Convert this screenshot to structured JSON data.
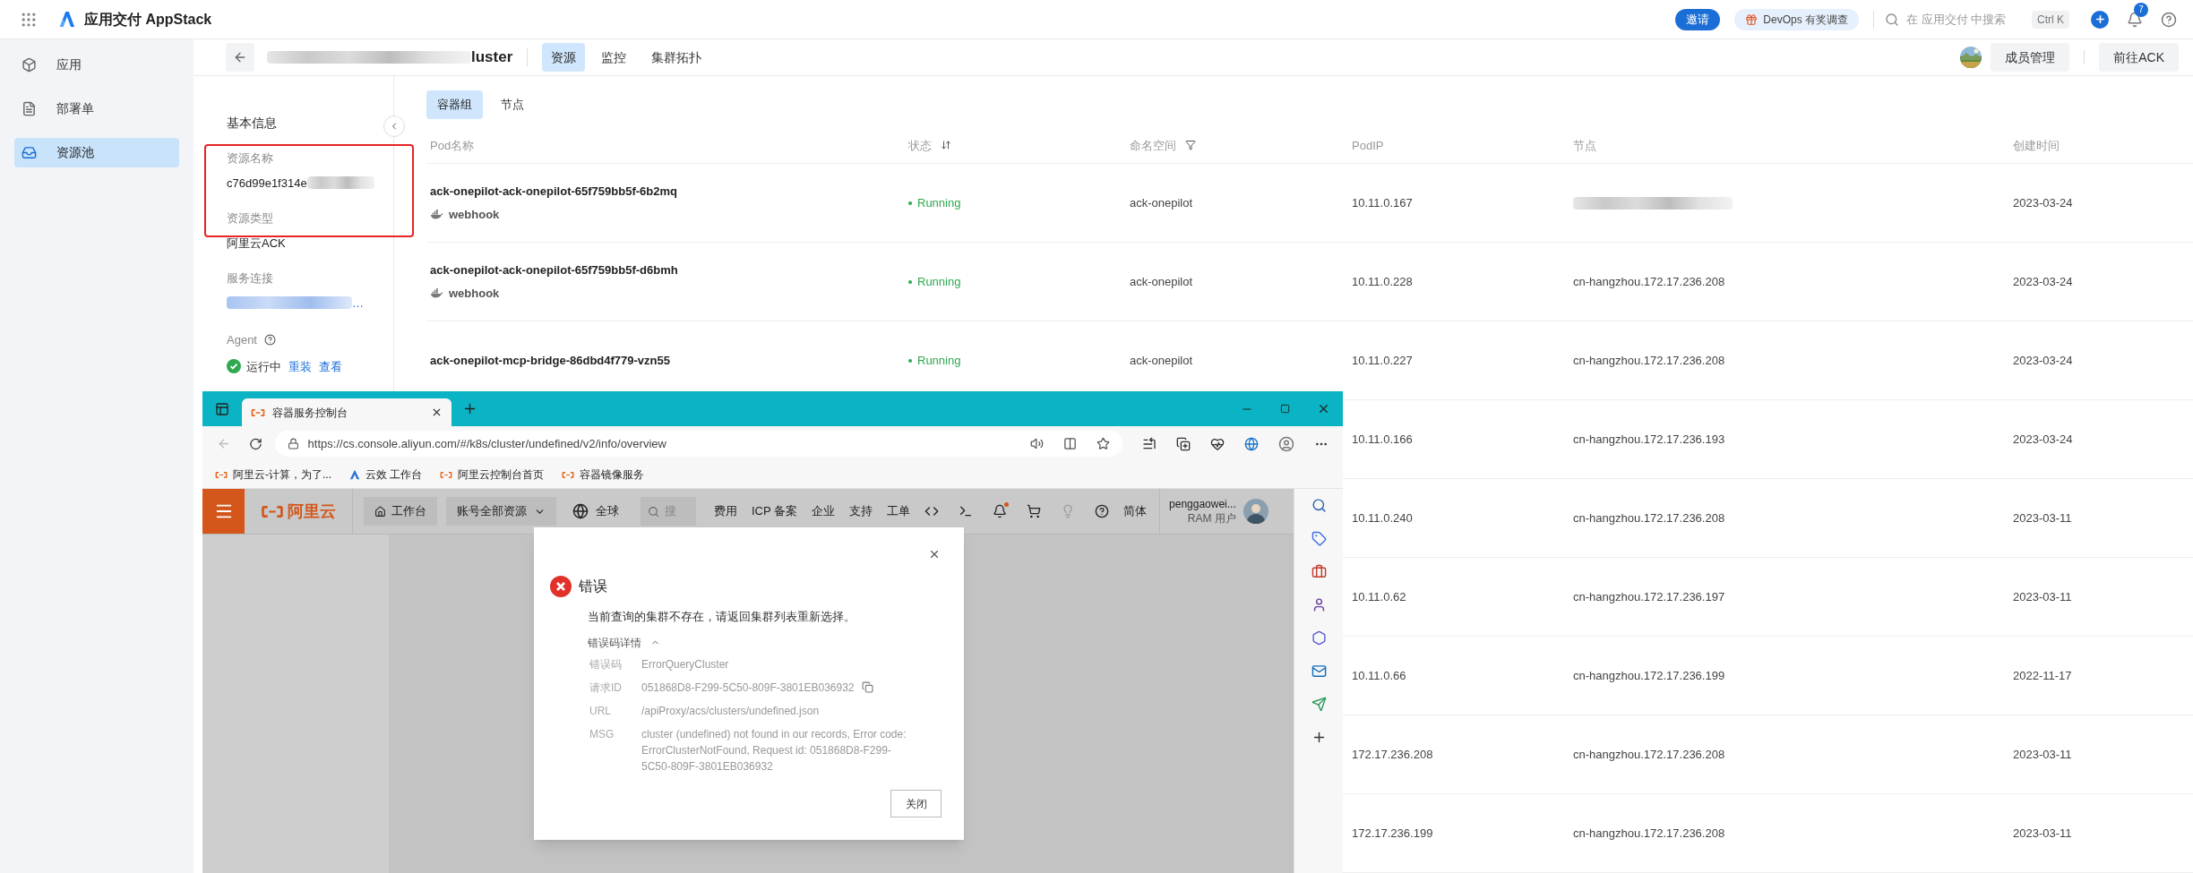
{
  "app": {
    "title": "应用交付 AppStack"
  },
  "top_bar": {
    "invite": "邀请",
    "survey": "DevOps 有奖调查",
    "search_placeholder": "在 应用交付 中搜索",
    "shortcut": "Ctrl K",
    "notification_count": "7"
  },
  "sidebar": {
    "items": [
      {
        "label": "应用",
        "kind": "app",
        "selected": false
      },
      {
        "label": "部署单",
        "kind": "deploy",
        "selected": false
      },
      {
        "label": "资源池",
        "kind": "pool",
        "selected": true
      }
    ]
  },
  "header": {
    "title": "luster",
    "title_redacted": true,
    "tabs": [
      {
        "label": "资源",
        "selected": true
      },
      {
        "label": "监控",
        "selected": false
      },
      {
        "label": "集群拓扑",
        "selected": false
      }
    ],
    "buttons": [
      "成员管理",
      "前往ACK"
    ]
  },
  "info_panel": {
    "title": "基本信息",
    "fields": [
      {
        "label": "资源名称",
        "value": "c76d99e1f314e",
        "kind": "text",
        "redacted": true
      },
      {
        "label": "资源类型",
        "value": "阿里云ACK",
        "kind": "text",
        "redacted": false
      },
      {
        "label": "服务连接",
        "value": "…",
        "kind": "link",
        "redacted": true
      }
    ],
    "agent": {
      "label": "Agent",
      "status": "运行中",
      "running": true,
      "actions": [
        "重装",
        "查看"
      ]
    }
  },
  "table_tabs": [
    {
      "label": "容器组",
      "selected": true
    },
    {
      "label": "节点",
      "selected": false
    }
  ],
  "table": {
    "columns": [
      {
        "label": "Pod名称",
        "kind": "plain"
      },
      {
        "label": "状态",
        "kind": "sort"
      },
      {
        "label": "命名空间",
        "kind": "filter"
      },
      {
        "label": "PodIP",
        "kind": "plain"
      },
      {
        "label": "节点",
        "kind": "plain"
      },
      {
        "label": "创建时间",
        "kind": "plain"
      }
    ],
    "rows": [
      {
        "pod": "ack-onepilot-ack-onepilot-65f759bb5f-6b2mq",
        "container": "webhook",
        "status": "Running",
        "healthy": true,
        "namespace": "ack-onepilot",
        "pod_ip": "10.11.0.167",
        "node_redacted": true,
        "created": "2023-03-24"
      },
      {
        "pod": "ack-onepilot-ack-onepilot-65f759bb5f-d6bmh",
        "container": "webhook",
        "status": "Running",
        "healthy": true,
        "namespace": "ack-onepilot",
        "pod_ip": "10.11.0.228",
        "node": "cn-hangzhou.172.17.236.208",
        "node_redacted": false,
        "created": "2023-03-24"
      },
      {
        "pod": "ack-onepilot-mcp-bridge-86dbd4f779-vzn55",
        "status": "Running",
        "healthy": true,
        "namespace": "ack-onepilot",
        "pod_ip": "10.11.0.227",
        "node": "cn-hangzhou.172.17.236.208",
        "node_redacted": false,
        "created": "2023-03-24"
      },
      {
        "pod_ip": "10.11.0.166",
        "node": "cn-hangzhou.172.17.236.193",
        "node_redacted": false,
        "created": "2023-03-24"
      },
      {
        "pod_ip": "10.11.0.240",
        "node": "cn-hangzhou.172.17.236.208",
        "node_redacted": false,
        "created": "2023-03-11"
      },
      {
        "pod_ip": "10.11.0.62",
        "node": "cn-hangzhou.172.17.236.197",
        "node_redacted": false,
        "created": "2023-03-11"
      },
      {
        "pod_ip": "10.11.0.66",
        "node": "cn-hangzhou.172.17.236.199",
        "node_redacted": false,
        "created": "2022-11-17"
      },
      {
        "pod_ip": "172.17.236.208",
        "node": "cn-hangzhou.172.17.236.208",
        "node_redacted": false,
        "created": "2023-03-11"
      },
      {
        "pod_ip": "172.17.236.199",
        "node": "cn-hangzhou.172.17.236.208",
        "node_redacted": false,
        "created": "2023-03-11"
      }
    ]
  },
  "browser": {
    "tab_title": "容器服务控制台",
    "url": "https://cs.console.aliyun.com/#/k8s/cluster/undefined/v2/info/overview",
    "bookmarks": [
      {
        "label": "阿里云-计算，为了...",
        "kind": "bracket"
      },
      {
        "label": "云效 工作台",
        "kind": "wave"
      },
      {
        "label": "阿里云控制台首页",
        "kind": "bracket"
      },
      {
        "label": "容器镜像服务",
        "kind": "bracket"
      }
    ]
  },
  "console": {
    "logo": "阿里云",
    "workbench": "工作台",
    "resource_scope": "账号全部资源",
    "region": "全球",
    "search_placeholder": "搜",
    "menu_items": [
      "费用",
      "ICP 备案",
      "企业",
      "支持",
      "工单"
    ],
    "notification_dot": true,
    "language": "简体",
    "user": {
      "name": "penggaowei...",
      "role": "RAM 用户"
    }
  },
  "dialog": {
    "title": "错误",
    "message": "当前查询的集群不存在，请返回集群列表重新选择。",
    "details_toggle": "错误码详情",
    "expanded": true,
    "details": [
      {
        "label": "错误码",
        "value": "ErrorQueryCluster",
        "copyable": false
      },
      {
        "label": "请求ID",
        "value": "051868D8-F299-5C50-809F-3801EB036932",
        "copyable": true
      },
      {
        "label": "URL",
        "value": "/apiProxy/acs/clusters/undefined.json",
        "copyable": false
      },
      {
        "label": "MSG",
        "value": "cluster (undefined) not found in our records, Error code: ErrorClusterNotFound, Request id: 051868D8-F299-5C50-809F-3801EB036932",
        "copyable": false
      }
    ],
    "button": "关闭"
  }
}
